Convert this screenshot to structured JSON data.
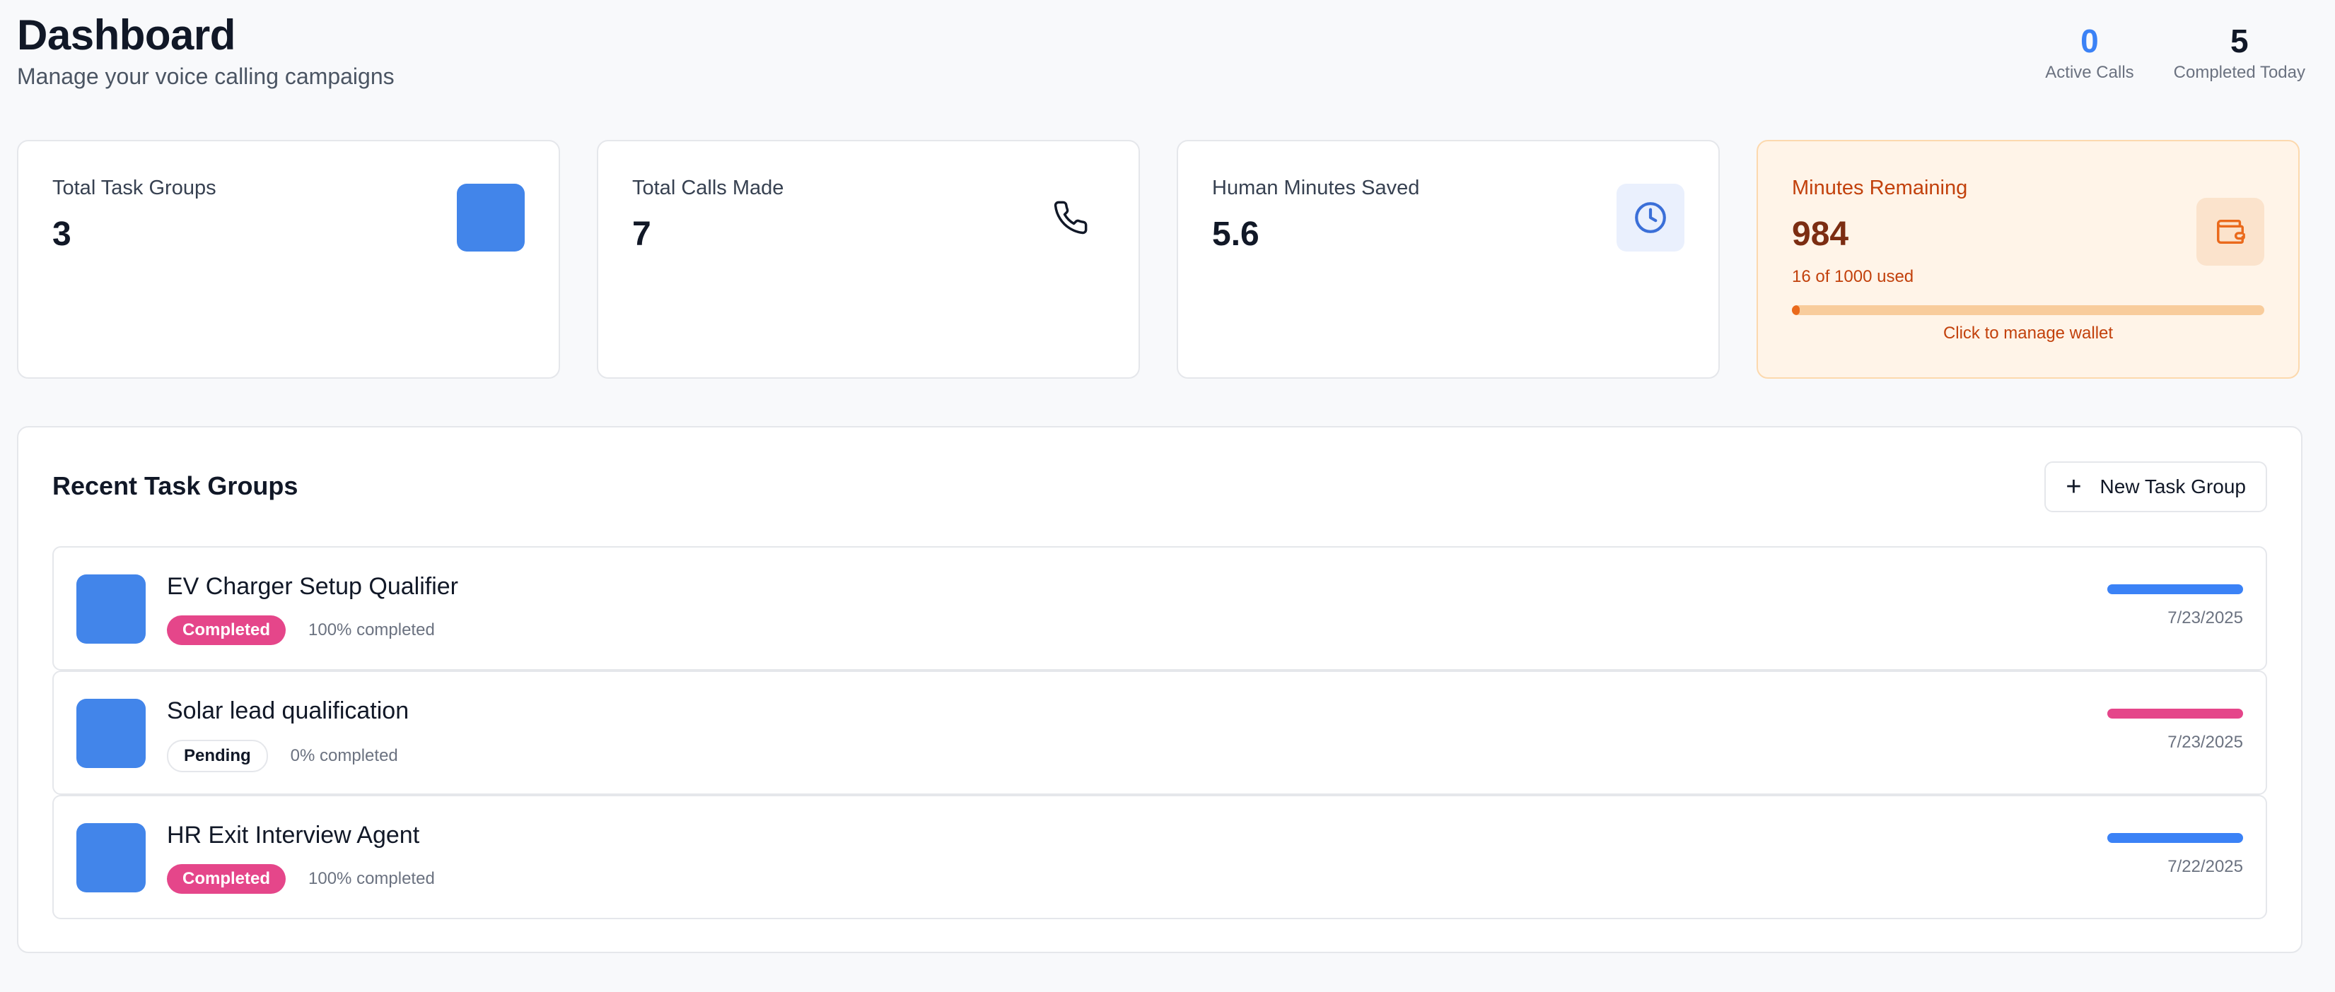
{
  "header": {
    "title": "Dashboard",
    "subtitle": "Manage your voice calling campaigns",
    "active_calls_value": "0",
    "active_calls_label": "Active Calls",
    "completed_today_value": "5",
    "completed_today_label": "Completed Today"
  },
  "cards": {
    "task_groups": {
      "label": "Total Task Groups",
      "value": "3"
    },
    "calls_made": {
      "label": "Total Calls Made",
      "value": "7"
    },
    "minutes_saved": {
      "label": "Human Minutes Saved",
      "value": "5.6"
    },
    "minutes_remaining": {
      "label": "Minutes Remaining",
      "value": "984",
      "used_text": "16 of 1000 used",
      "used_fraction": 0.016,
      "manage_text": "Click to manage wallet"
    }
  },
  "recent": {
    "title": "Recent Task Groups",
    "new_button_label": "New Task Group",
    "rows": [
      {
        "name": "EV Charger Setup Qualifier",
        "status": "Completed",
        "progress_text": "100% completed",
        "date": "7/23/2025"
      },
      {
        "name": "Solar lead qualification",
        "status": "Pending",
        "progress_text": "0% completed",
        "date": "7/23/2025"
      },
      {
        "name": "HR Exit Interview Agent",
        "status": "Completed",
        "progress_text": "100% completed",
        "date": "7/22/2025"
      }
    ]
  },
  "colors": {
    "accent_blue": "#3b82f6",
    "pink": "#e5468a",
    "orange": "#ea6a1c"
  }
}
